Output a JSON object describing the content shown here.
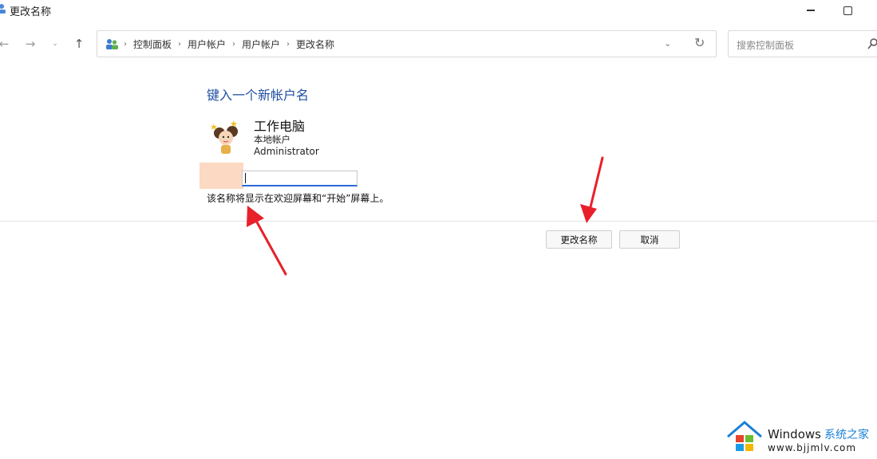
{
  "window": {
    "title": "更改名称"
  },
  "nav": {
    "back_icon": "←",
    "forward_icon": "→",
    "recent_icon": "⌄",
    "up_icon": "↑"
  },
  "address_bar": {
    "crumbs": [
      "控制面板",
      "用户帐户",
      "用户帐户",
      "更改名称"
    ],
    "separator": "›",
    "dropdown_icon": "⌄",
    "refresh_icon": "↻"
  },
  "search": {
    "placeholder": "搜索控制面板"
  },
  "content": {
    "heading": "键入一个新帐户名",
    "account_name": "工作电脑",
    "account_type": "本地帐户",
    "account_group": "Administrator",
    "new_name_value": "",
    "hint": "该名称将显示在欢迎屏幕和“开始”屏幕上。"
  },
  "buttons": {
    "rename": "更改名称",
    "cancel": "取消"
  },
  "watermark": {
    "brand": "Windows",
    "brand_cn": "系统之家",
    "url": "www.bjjmlv.com"
  },
  "colors": {
    "heading": "#1f4fa3",
    "annotation_arrow": "#e8202a",
    "input_focus": "#2a6ad8"
  }
}
